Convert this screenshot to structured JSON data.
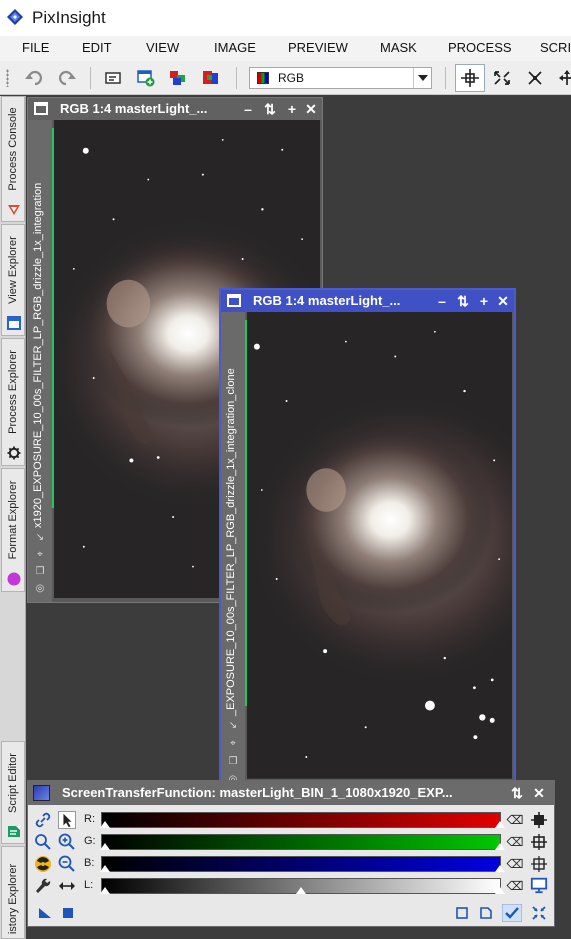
{
  "app": {
    "title": "PixInsight"
  },
  "menu": [
    "FILE",
    "EDIT",
    "VIEW",
    "IMAGE",
    "PREVIEW",
    "MASK",
    "PROCESS",
    "SCRI"
  ],
  "toolbar": {
    "view_selector_value": "RGB",
    "icons": [
      "undo-icon",
      "redo-icon",
      "duplicate-view-icon",
      "new-image-icon",
      "rgb-channels-icon",
      "extract-channel-icon",
      "navigate-mode-icon",
      "fit-view-icon",
      "zoom-to-fit-icon",
      "pan-icon"
    ]
  },
  "dock_tabs": [
    "Process Console",
    "View Explorer",
    "Process Explorer",
    "Format Explorer",
    "Script Editor",
    "istory Explorer"
  ],
  "windows": [
    {
      "title": "RGB 1:4 masterLight_...",
      "view_id": "x1920_EXPOSURE_10_00s_FILTER_LP_RGB_drizzle_1x_integration",
      "active": false
    },
    {
      "title": "RGB 1:4 masterLight_...",
      "view_id": "_EXPOSURE_10_00s_FILTER_LP_RGB_drizzle_1x_integration_clone",
      "active": true
    }
  ],
  "stf": {
    "title": "ScreenTransferFunction: masterLight_BIN_1_1080x1920_EXP...",
    "channels": [
      {
        "label": "R:",
        "color": "#e00000"
      },
      {
        "label": "G:",
        "color": "#00c800"
      },
      {
        "label": "B:",
        "color": "#0000e0"
      },
      {
        "label": "L:",
        "color": "#ffffff",
        "midtones": 0.5
      }
    ]
  },
  "colors": {
    "active_window": "#3f51c5",
    "inactive_window": "#616161",
    "channel_mark": "#22c55e"
  }
}
